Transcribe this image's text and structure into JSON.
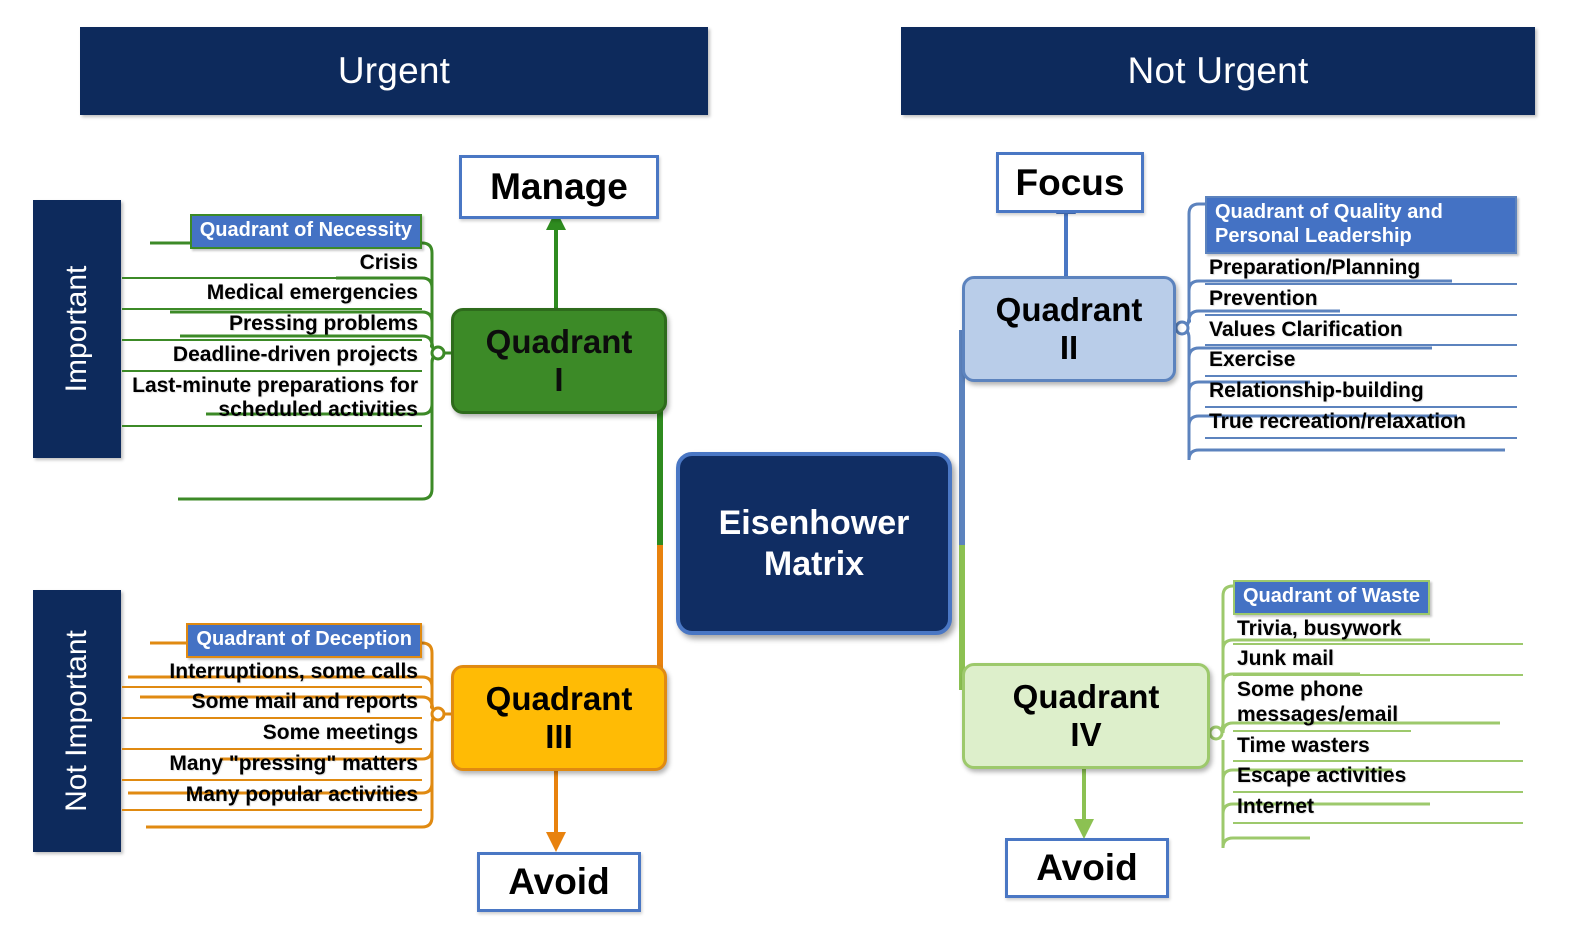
{
  "axes": {
    "top_left": "Urgent",
    "top_right": "Not Urgent",
    "side_top": "Important",
    "side_bottom": "Not Important"
  },
  "center": {
    "title_line1": "Eisenhower",
    "title_line2": "Matrix"
  },
  "actions": {
    "manage": "Manage",
    "focus": "Focus",
    "avoid_left": "Avoid",
    "avoid_right": "Avoid"
  },
  "quadrants": {
    "q1": {
      "name_line1": "Quadrant",
      "name_line2": "I",
      "heading": "Quadrant of Necessity",
      "items": [
        "Crisis",
        "Medical emergencies",
        "Pressing problems",
        "Deadline-driven projects",
        "Last-minute preparations for scheduled activities"
      ],
      "action": "Manage",
      "color": "#3C8A27"
    },
    "q2": {
      "name_line1": "Quadrant",
      "name_line2": "II",
      "heading": "Quadrant of Quality and Personal Leadership",
      "items": [
        "Preparation/Planning",
        "Prevention",
        "Values Clarification",
        "Exercise",
        "Relationship-building",
        "True recreation/relaxation"
      ],
      "action": "Focus",
      "color": "#5C83BE"
    },
    "q3": {
      "name_line1": "Quadrant",
      "name_line2": "III",
      "heading": "Quadrant of Deception",
      "items": [
        "Interruptions, some calls",
        "Some mail and reports",
        "Some meetings",
        "Many \"pressing\" matters",
        "Many popular activities"
      ],
      "action": "Avoid",
      "color": "#E08A11"
    },
    "q4": {
      "name_line1": "Quadrant",
      "name_line2": "IV",
      "heading": "Quadrant of Waste",
      "items": [
        "Trivia, busywork",
        "Junk mail",
        "Some phone messages/email",
        "Time wasters",
        "Escape activities",
        "Internet"
      ],
      "action": "Avoid",
      "color": "#9DC96C"
    }
  },
  "colors": {
    "navy": "#0D2A5C",
    "center_fill": "#102D63",
    "center_border": "#4A77C4",
    "heading_fill": "#4472C4",
    "q1_fill": "#3C8A27",
    "q2_fill": "#B9CDE9",
    "q3_fill": "#FFBB05",
    "q4_fill": "#DDEFCB"
  }
}
